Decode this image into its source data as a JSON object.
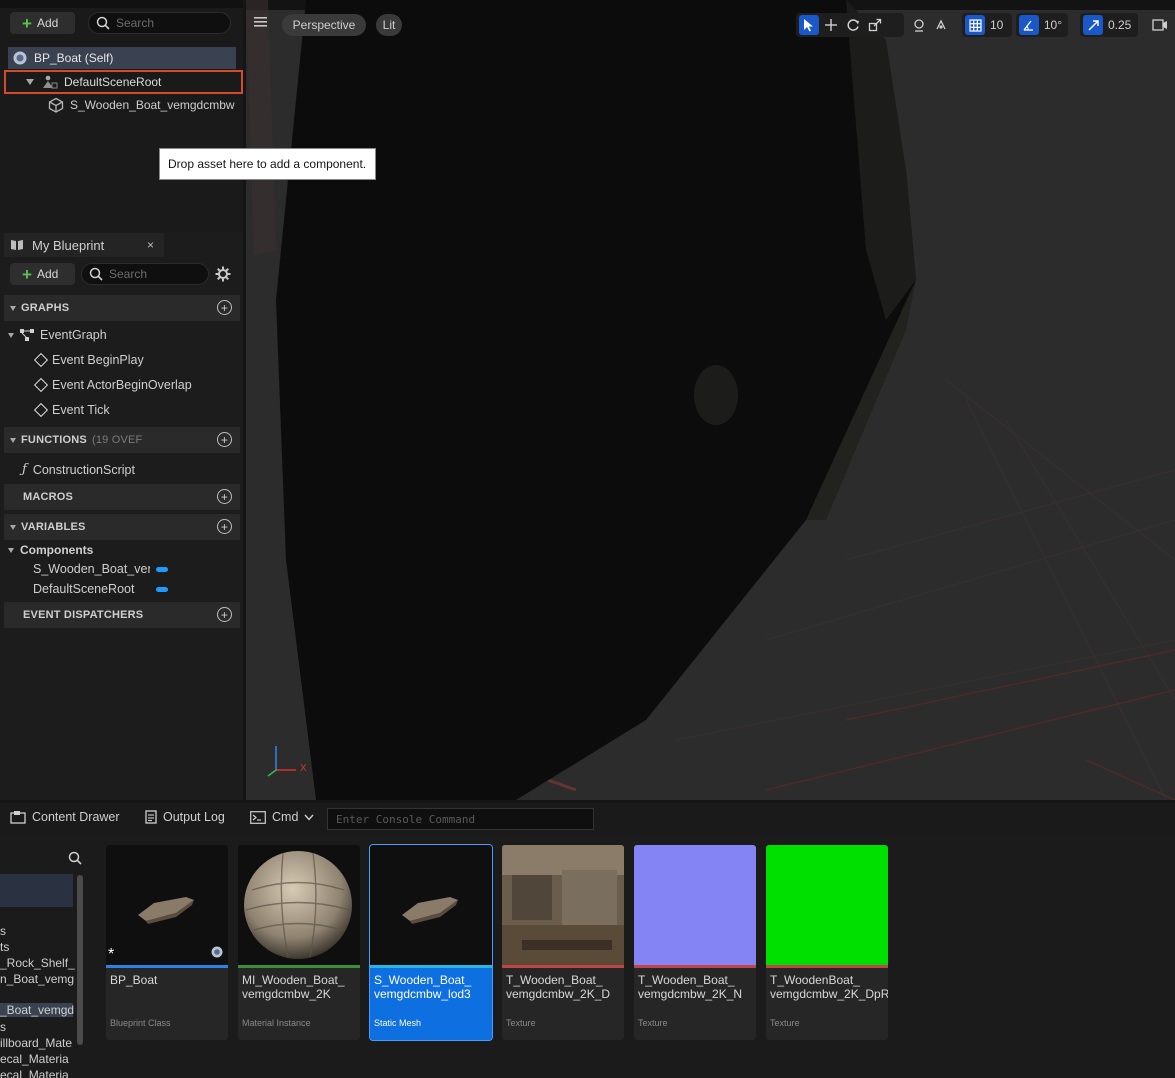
{
  "components_panel": {
    "add_label": "Add",
    "search_placeholder": "Search",
    "tree": {
      "self": "BP_Boat (Self)",
      "root": "DefaultSceneRoot",
      "mesh": "S_Wooden_Boat_vemgdcmbw"
    },
    "tooltip": "Drop asset here to add a component."
  },
  "my_blueprint": {
    "tab_label": "My Blueprint",
    "close_glyph": "×",
    "add_label": "Add",
    "search_placeholder": "Search",
    "sections": {
      "graphs": "GRAPHS",
      "functions": "FUNCTIONS",
      "functions_count": "(19 OVEF",
      "macros": "MACROS",
      "variables": "VARIABLES",
      "event_dispatchers": "EVENT DISPATCHERS"
    },
    "event_graph": "EventGraph",
    "events": [
      "Event BeginPlay",
      "Event ActorBeginOverlap",
      "Event Tick"
    ],
    "construction_script": "ConstructionScript",
    "components_category": "Components",
    "component_vars": [
      "S_Wooden_Boat_ver",
      "DefaultSceneRoot"
    ]
  },
  "viewport": {
    "perspective_label": "Perspective",
    "lit_label": "Lit",
    "grid_snap_value": "10",
    "rotation_snap_value": "10°",
    "scale_snap_value": "0.25",
    "axis_x_label": "X"
  },
  "bottom_bar": {
    "content_drawer_label": "Content Drawer",
    "output_log_label": "Output Log",
    "cmd_label": "Cmd",
    "console_placeholder": "Enter Console Command"
  },
  "content_drawer": {
    "left_tree_lines": [
      "s",
      "ts",
      "_Rock_Shelf_",
      "n_Boat_vemg",
      "_Boat_vemgd",
      "s",
      "illboard_Mate",
      "ecal_Materia",
      "ecal_Materia"
    ],
    "assets": [
      {
        "name": "BP_Boat",
        "type": "Blueprint Class",
        "bar_color": "#2a83e0"
      },
      {
        "name": "MI_Wooden_Boat_ vemgdcmbw_2K",
        "type": "Material Instance",
        "bar_color": "#3b8f3b"
      },
      {
        "name": "S_Wooden_Boat_ vemgdcmbw_lod3",
        "type": "Static Mesh",
        "bar_color": "#2ab4e0"
      },
      {
        "name": "T_Wooden_Boat_ vemgdcmbw_2K_D",
        "type": "Texture",
        "bar_color": "#c0444a"
      },
      {
        "name": "T_Wooden_Boat_ vemgdcmbw_2K_N",
        "type": "Texture",
        "bar_color": "#c0444a"
      },
      {
        "name": "T_WoodenBoat_ vemgdcmbw_2K_DpR",
        "type": "Texture",
        "bar_color": "#c0444a"
      }
    ]
  },
  "colors": {
    "accent_blue": "#1a58c8",
    "selection_blue": "#0d6fe0",
    "highlight_red": "#d44a2a",
    "normal_map": "#8484f5",
    "green_texture": "#00e000"
  }
}
